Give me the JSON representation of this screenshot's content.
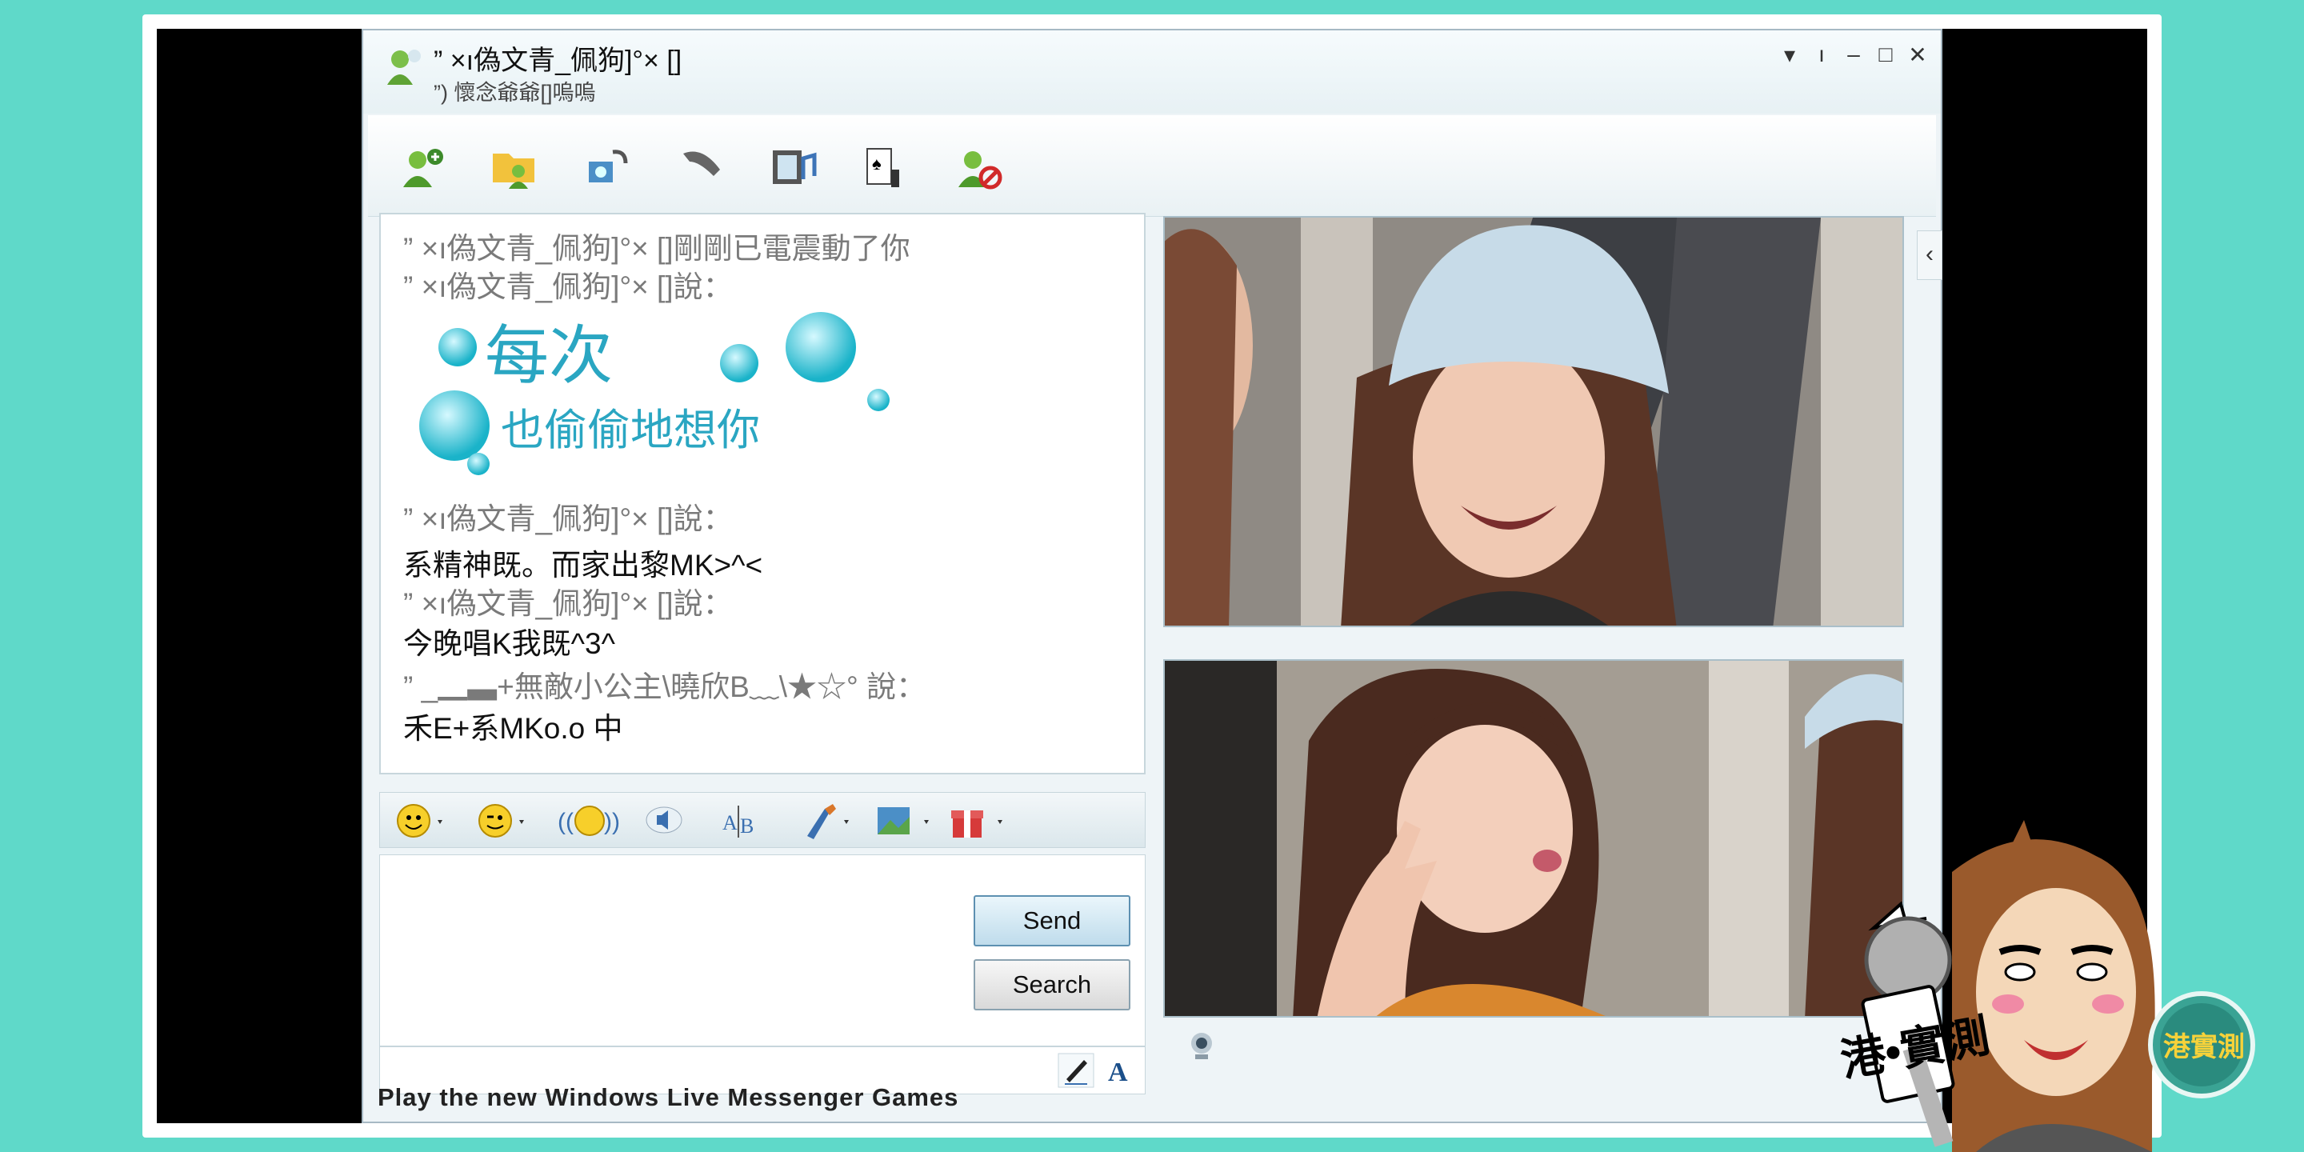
{
  "window": {
    "title": "” ×ı偽文青_佩狗]°× []",
    "subtitle": "”) 懷念爺爺[]嗚嗚",
    "controls": [
      "▾",
      "ı",
      "‒",
      "□",
      "✕"
    ]
  },
  "toolbar": {
    "icons": [
      "add-contact-icon",
      "share-folder-icon",
      "video-call-icon",
      "phone-icon",
      "activities-icon",
      "games-icon",
      "block-contact-icon"
    ]
  },
  "chat": {
    "lines": [
      {
        "type": "header",
        "text": "” ×ı偽文青_佩狗]°× []剛剛已電震動了你"
      },
      {
        "type": "header",
        "text": "” ×ı偽文青_佩狗]°× []說："
      },
      {
        "type": "header",
        "text": "” ×ı偽文青_佩狗]°× []說："
      },
      {
        "type": "message",
        "text": "系精神既。而家出黎MK>^<"
      },
      {
        "type": "header",
        "text": "” ×ı偽文青_佩狗]°× []說："
      },
      {
        "type": "message",
        "text": "今晚唱K我既^3^"
      },
      {
        "type": "header",
        "text": "” _▁▃+無敵小公主\\曉欣B﹏\\★☆° 說："
      },
      {
        "type": "message",
        "text": "禾E+系MKo.o 中"
      }
    ],
    "sticker": {
      "line1": "每次",
      "line2": "也偷偷地想你"
    }
  },
  "format_bar": {
    "icons": [
      "emoticon-icon",
      "wink-icon",
      "nudge-icon",
      "voice-clip-icon",
      "font-icon",
      "background-icon",
      "wallpaper-icon",
      "gift-icon"
    ]
  },
  "input": {
    "send_label": "Send",
    "search_label": "Search"
  },
  "status_bar": {
    "ticker": "Play the new Windows Live Messenger Games"
  },
  "overlay": {
    "badge": "港•實測",
    "logo": "港實測"
  }
}
